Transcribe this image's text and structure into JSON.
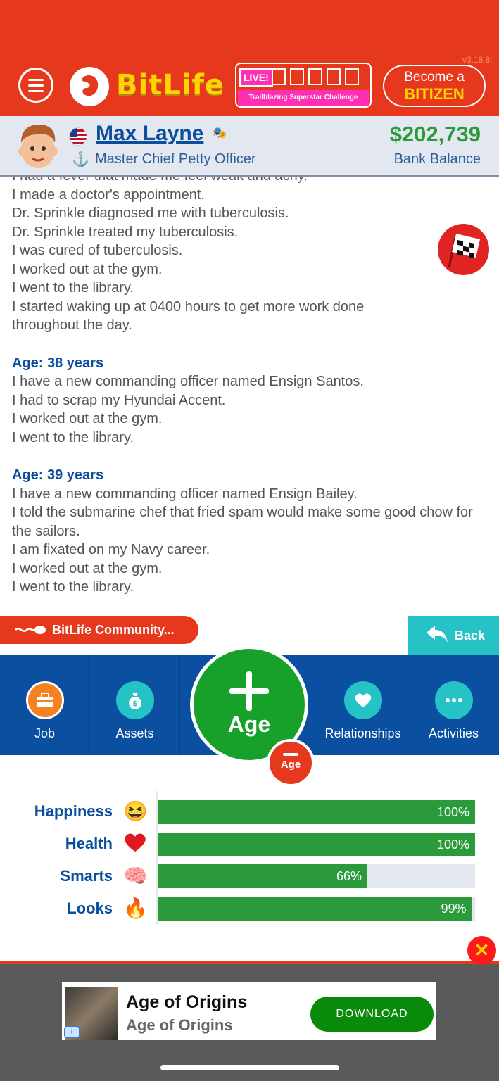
{
  "header": {
    "version": "v3.18.8i",
    "logo_text": "BitLife",
    "live_label": "LIVE!",
    "live_subtitle": "Trailblazing Superstar Challenge",
    "bitizen_top": "Become a",
    "bitizen_bottom": "BITIZEN"
  },
  "profile": {
    "name": "Max Layne",
    "job": "Master Chief Petty Officer",
    "balance": "$202,739",
    "balance_label": "Bank Balance"
  },
  "log": {
    "partial_line": "I had a fever that made me feel weak and achy.",
    "lines_a": [
      "I made a doctor's appointment.",
      "Dr. Sprinkle diagnosed me with tuberculosis.",
      "Dr. Sprinkle treated my tuberculosis.",
      "I was cured of tuberculosis.",
      "I worked out at the gym.",
      "I went to the library.",
      "I started waking up at 0400 hours to get more work done throughout the day."
    ],
    "age_38": "Age: 38 years",
    "lines_38": [
      "I have a new commanding officer named Ensign Santos.",
      "I had to scrap my Hyundai Accent.",
      "I worked out at the gym.",
      "I went to the library."
    ],
    "age_39": "Age: 39 years",
    "lines_39": [
      "I have a new commanding officer named Ensign Bailey.",
      "I told the submarine chef that fried spam would make some good chow for the sailors.",
      "I am fixated on my Navy career.",
      "I worked out at the gym.",
      "I went to the library."
    ]
  },
  "community_label": "BitLife Community...",
  "back_label": "Back",
  "nav": {
    "job": "Job",
    "assets": "Assets",
    "age": "Age",
    "age_minus": "Age",
    "relationships": "Relationships",
    "activities": "Activities"
  },
  "stats": {
    "happiness": {
      "label": "Happiness",
      "value": 100,
      "text": "100%"
    },
    "health": {
      "label": "Health",
      "value": 100,
      "text": "100%"
    },
    "smarts": {
      "label": "Smarts",
      "value": 66,
      "text": "66%"
    },
    "looks": {
      "label": "Looks",
      "value": 99,
      "text": "99%"
    }
  },
  "ad": {
    "title": "Age of Origins",
    "subtitle": "Age of Origins",
    "button": "DOWNLOAD"
  },
  "colors": {
    "header_red": "#e5381c",
    "brand_yellow": "#ffd400",
    "nav_blue": "#0a4fa0",
    "stat_green": "#2a9a3a",
    "teal": "#25c2c6"
  }
}
